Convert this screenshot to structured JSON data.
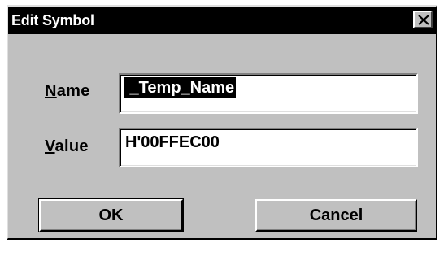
{
  "window": {
    "title": "Edit Symbol",
    "close_icon": "close-x-icon"
  },
  "fields": {
    "name": {
      "mnemonic": "N",
      "label_rest": "ame",
      "value": " _Temp_Name"
    },
    "value": {
      "mnemonic": "V",
      "label_rest": "alue",
      "value": "H'00FFEC00"
    }
  },
  "buttons": {
    "ok_label": "OK",
    "cancel_label": "Cancel"
  },
  "colors": {
    "dialog_face": "#c0c0c0",
    "titlebar": "#000000",
    "selection": "#000000"
  }
}
